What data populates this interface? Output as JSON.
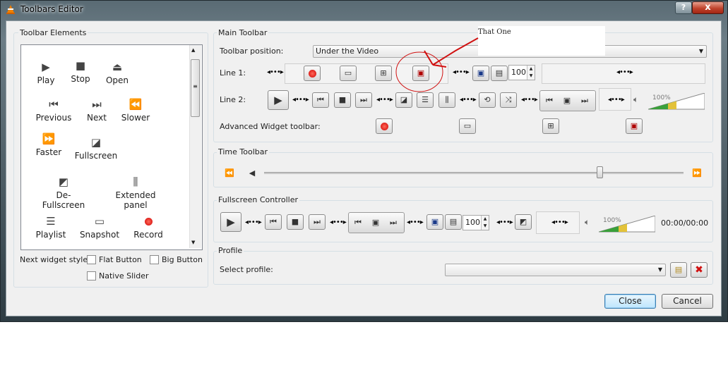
{
  "window": {
    "title": "Toolbars Editor",
    "help": "?",
    "close": "x"
  },
  "elements": {
    "title": "Toolbar Elements",
    "items": [
      {
        "label": "Play",
        "icon": "play-icon"
      },
      {
        "label": "Stop",
        "icon": "stop-icon"
      },
      {
        "label": "Open",
        "icon": "eject-icon"
      },
      {
        "label": "Previous",
        "icon": "previous-icon"
      },
      {
        "label": "Next",
        "icon": "next-icon"
      },
      {
        "label": "Slower",
        "icon": "slower-icon"
      },
      {
        "label": "Faster",
        "icon": "faster-icon"
      },
      {
        "label": "Fullscreen",
        "icon": "fullscreen-icon"
      },
      {
        "label": "De-Fullscreen",
        "icon": "defullscreen-icon"
      },
      {
        "label": "Extended panel",
        "icon": "extended-panel-icon"
      },
      {
        "label": "Playlist",
        "icon": "playlist-icon"
      },
      {
        "label": "Snapshot",
        "icon": "snapshot-icon"
      },
      {
        "label": "Record",
        "icon": "record-icon"
      }
    ],
    "style_label": "Next widget style:",
    "flat_button": "Flat Button",
    "big_button": "Big Button",
    "native_slider": "Native Slider"
  },
  "main": {
    "title": "Main Toolbar",
    "position_label": "Toolbar position:",
    "position_value": "Under the Video",
    "line1_label": "Line 1:",
    "line2_label": "Line 2:",
    "advanced_label": "Advanced Widget toolbar:",
    "zoom_value": "100",
    "volume_percent": "100%",
    "annotation": "That One"
  },
  "time": {
    "title": "Time Toolbar",
    "slider_position": 0.8
  },
  "fullscreen": {
    "title": "Fullscreen Controller",
    "zoom_value": "100",
    "volume_percent": "100%",
    "time": "00:00/00:00"
  },
  "profile": {
    "title": "Profile",
    "select_label": "Select profile:",
    "value": ""
  },
  "buttons": {
    "close": "Close",
    "cancel": "Cancel"
  },
  "colors": {
    "accent": "#3c7fb1",
    "record": "#d00000",
    "annotation": "#d01010"
  }
}
